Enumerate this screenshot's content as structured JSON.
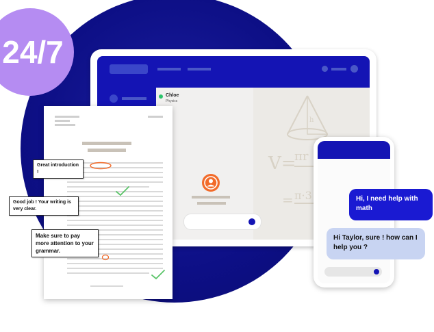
{
  "badge": {
    "text": "24/7"
  },
  "session": {
    "name": "Chloe",
    "subject": "Physics"
  },
  "notes": [
    {
      "text": "Great introduction !"
    },
    {
      "text": "Good job ! Your writing is very clear."
    },
    {
      "text": "Make sure to pay more attention to your grammar."
    }
  ],
  "chat": [
    {
      "text": "Hi, I need help with math"
    },
    {
      "text": "Hi Taylor, sure ! how can I help you ?"
    }
  ],
  "colors": {
    "brand_blue": "#1414b4",
    "accent_purple": "#b58cf2",
    "status_green": "#2cc36b",
    "avatar_orange": "#f26b2a"
  }
}
